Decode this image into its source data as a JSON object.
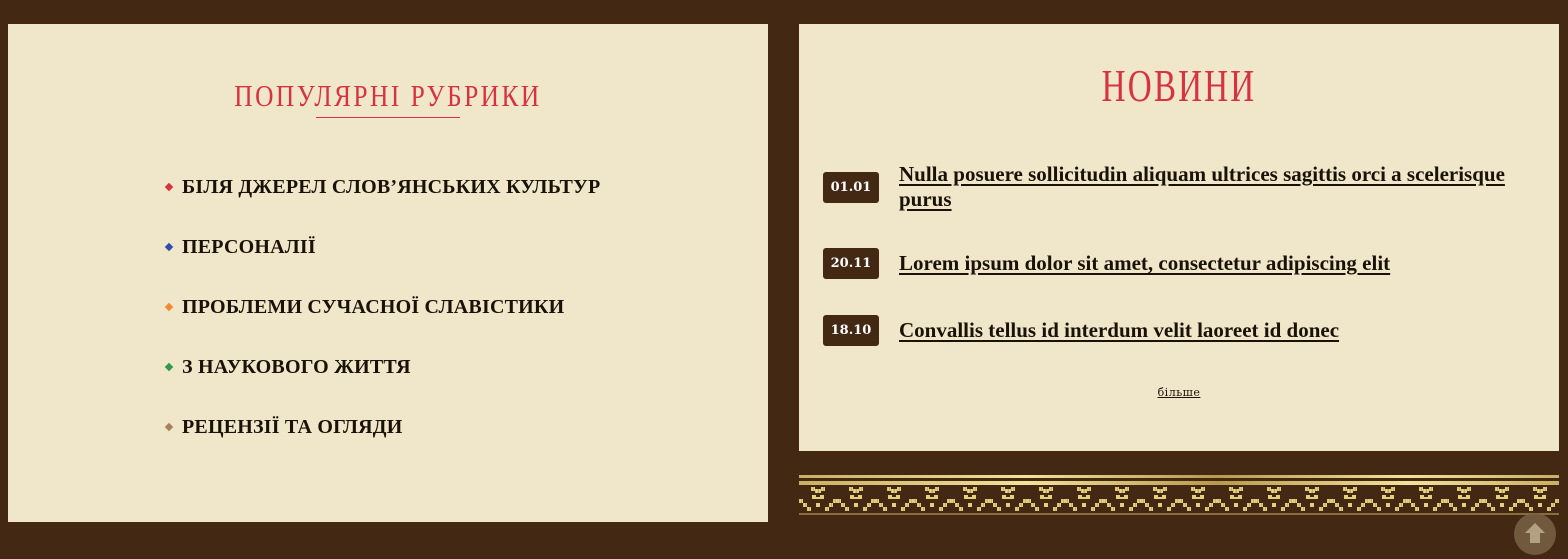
{
  "rubrics": {
    "title": "ПОПУЛЯРНІ РУБРИКИ",
    "items": [
      {
        "label": "БІЛЯ ДЖЕРЕЛ СЛОВ’ЯНСЬКИХ КУЛЬТУР",
        "color": "#d7323f"
      },
      {
        "label": "ПЕРСОНАЛІЇ",
        "color": "#2f4fb0"
      },
      {
        "label": "ПРОБЛЕМИ СУЧАСНОЇ СЛАВІСТИКИ",
        "color": "#f08a30"
      },
      {
        "label": "З НАУКОВОГО ЖИТТЯ",
        "color": "#2e9a4a"
      },
      {
        "label": "РЕЦЕНЗІЇ ТА ОГЛЯДИ",
        "color": "#a8825a"
      }
    ]
  },
  "news": {
    "title": "НОВИНИ",
    "items": [
      {
        "date": "01.01",
        "title": "Nulla posuere sollicitudin aliquam ultrices sagittis orci a scelerisque purus"
      },
      {
        "date": "20.11",
        "title": "Lorem ipsum dolor sit amet, consectetur adipiscing elit"
      },
      {
        "date": "18.10",
        "title": "Convallis tellus id interdum velit laoreet id donec"
      }
    ],
    "more_label": "більше"
  },
  "colors": {
    "background": "#432814",
    "panel": "#f0e6c9",
    "accent": "#d7323f",
    "ornament_gold": "#e4cf7e"
  },
  "icons": {
    "scroll_top": "arrow-up-icon",
    "ornament": "embroidery-ornament"
  }
}
